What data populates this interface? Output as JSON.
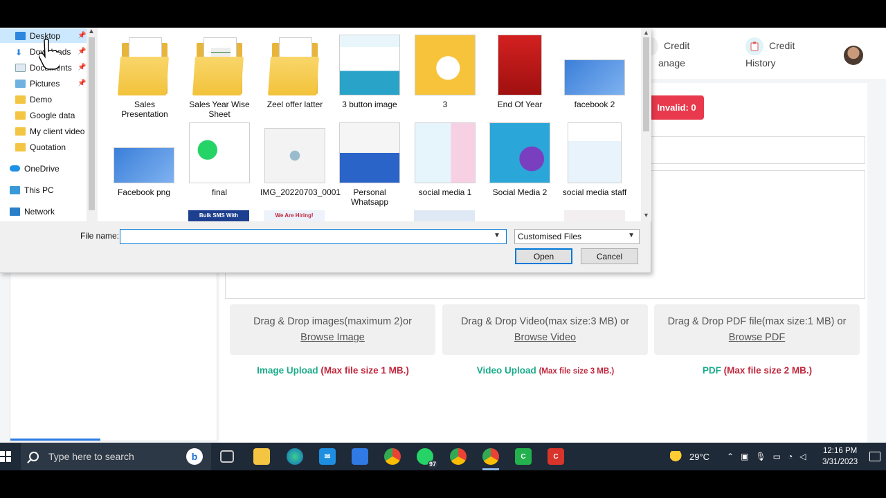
{
  "header": {
    "credit_manage": {
      "line1": "Credit",
      "line2": "anage"
    },
    "credit_history": {
      "line1": "Credit",
      "line2": "History"
    }
  },
  "stats": {
    "invalid_label": "Invalid: 0"
  },
  "upload": {
    "image": {
      "line1": "Drag & Drop images(maximum 2)or",
      "browse": "Browse Image",
      "note_title": "Image Upload",
      "note_size": "(Max file size 1 MB.)"
    },
    "video": {
      "line1": "Drag & Drop Video(max size:3 MB) or",
      "browse": "Browse Video",
      "note_title": "Video Upload",
      "note_size": "(Max file size 3 MB.)"
    },
    "pdf": {
      "line1": "Drag & Drop PDF file(max size:1 MB) or",
      "browse": "Browse PDF",
      "note_title": "PDF",
      "note_size": "(Max file size 2 MB.)"
    }
  },
  "dialog": {
    "nav": [
      {
        "label": "Desktop",
        "icon": "desktop-icon",
        "pinned": true,
        "selected": true
      },
      {
        "label": "Downloads",
        "icon": "download-icon",
        "pinned": true
      },
      {
        "label": "Documents",
        "icon": "documents-icon",
        "pinned": true
      },
      {
        "label": "Pictures",
        "icon": "pictures-icon",
        "pinned": true
      },
      {
        "label": "Demo",
        "icon": "folder-icon"
      },
      {
        "label": "Google data",
        "icon": "folder-icon"
      },
      {
        "label": "My client video",
        "icon": "folder-icon"
      },
      {
        "label": "Quotation",
        "icon": "folder-icon"
      },
      {
        "label": "OneDrive",
        "icon": "cloud-icon"
      },
      {
        "label": "This PC",
        "icon": "computer-icon"
      },
      {
        "label": "Network",
        "icon": "network-icon"
      }
    ],
    "files": [
      {
        "name": "Sales Presentation",
        "kind": "folder-pdf"
      },
      {
        "name": "Sales Year Wise Sheet",
        "kind": "folder-sheet"
      },
      {
        "name": "Zeel offer latter",
        "kind": "folder-pdf"
      },
      {
        "name": "3 button image",
        "kind": "image"
      },
      {
        "name": "3",
        "kind": "image"
      },
      {
        "name": "End Of Year",
        "kind": "image"
      },
      {
        "name": "facebook 2",
        "kind": "image"
      },
      {
        "name": "Facebook png",
        "kind": "image"
      },
      {
        "name": "final",
        "kind": "image"
      },
      {
        "name": "IMG_20220703_0001",
        "kind": "image"
      },
      {
        "name": "Personal Whatsapp",
        "kind": "image"
      },
      {
        "name": "social media 1",
        "kind": "image"
      },
      {
        "name": "Social Media 2",
        "kind": "image"
      },
      {
        "name": "social media staff",
        "kind": "image"
      }
    ],
    "partial_thumbs": {
      "bulk_sms": "Bulk SMS With",
      "hiring": "We Are Hiring!"
    },
    "file_name_label": "File name:",
    "file_name_value": "",
    "filter": "Customised Files",
    "open_label": "Open",
    "cancel_label": "Cancel"
  },
  "taskbar": {
    "search_placeholder": "Type here to search",
    "whatsapp_badge": "97",
    "weather": "29°C",
    "time": "12:16 PM",
    "date": "3/31/2023"
  },
  "colors": {
    "invalid": "#e8394d",
    "upload_title": "#1aab8a",
    "upload_size": "#c0273d",
    "selection": "#cce8ff",
    "focus": "#0078d7"
  }
}
